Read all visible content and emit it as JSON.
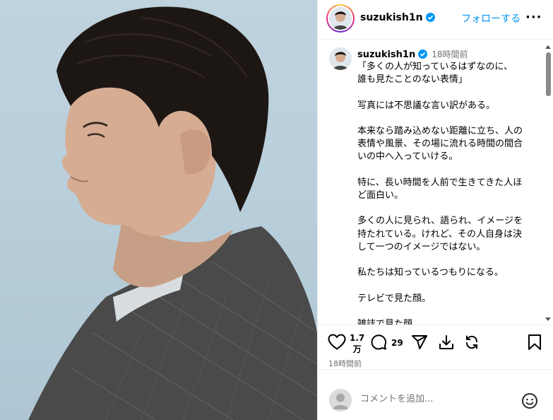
{
  "post": {
    "username": "suzukish1n",
    "follow_label": "フォローする",
    "more_label": "···"
  },
  "caption": {
    "username": "suzukish1n",
    "time": "18時間前",
    "text": "「多くの人が知っているはずなのに、\n誰も見たことのない表情」\n\n写真には不思議な言い訳がある。\n\n本来なら踏み込めない距離に立ち、人の表情や風景、その場に流れる時間の間合いの中へ入っていける。\n\n特に、長い時間を人前で生きてきた人ほど面白い。\n\n多くの人に見られ、語られ、イメージを持たれている。けれど、その人自身は決して一つのイメージではない。\n\n私たちは知っているつもりになる。\n\nテレビで見た顔。\n\n雑誌で見た顔。"
  },
  "actions": {
    "like_count_line1": "1.7",
    "like_count_line2": "万",
    "comment_count": "29",
    "posted": "18時間前"
  },
  "comment_box": {
    "placeholder": "コメントを追加..."
  },
  "icons": [
    "heart-icon",
    "comment-icon",
    "share-icon",
    "download-icon",
    "repost-icon",
    "bookmark-icon",
    "emoji-icon",
    "verified-badge-icon",
    "more-options-icon"
  ],
  "colors": {
    "accent": "#0095f6",
    "verified": "#0095f6",
    "muted": "#737373"
  }
}
